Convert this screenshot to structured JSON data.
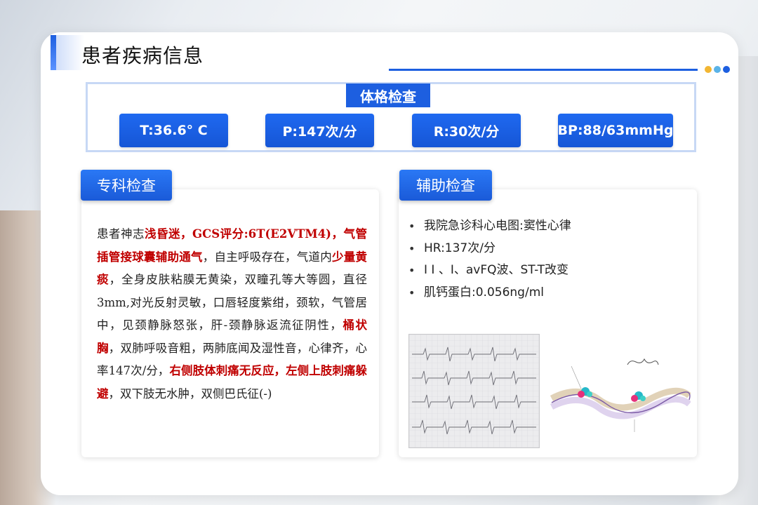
{
  "header": {
    "title": "患者疾病信息"
  },
  "colors": {
    "accent": "#1d5fe0",
    "highlight_red": "#c00000",
    "dots": [
      "#f2b632",
      "#5ab3e8",
      "#1d5fe0"
    ]
  },
  "physical_exam": {
    "title": "体格检查",
    "vitals": [
      {
        "label": "T:36.6° C"
      },
      {
        "label": "P:147次/分"
      },
      {
        "label": "R:30次/分"
      },
      {
        "label": "BP:88/63mmHg"
      }
    ]
  },
  "specialist_exam": {
    "title": "专科检查",
    "segments": [
      {
        "text": "患者神志",
        "red": false
      },
      {
        "text": "浅昏迷，GCS评分:6T(E2VTM4)，气管插管接球囊辅助通气",
        "red": true
      },
      {
        "text": "，自主呼吸存在，气道内",
        "red": false
      },
      {
        "text": "少量黄痰",
        "red": true
      },
      {
        "text": "，全身皮肤粘膜无黄染，双瞳孔等大等圆，直径3mm,对光反射灵敏，口唇轻度紫绀，颈软，气管居中，见颈静脉怒张，肝-颈静脉返流征阴性，",
        "red": false
      },
      {
        "text": "桶状胸",
        "red": true
      },
      {
        "text": "，双肺呼吸音粗，两肺底闻及湿性音，心律齐，心率147次/分，",
        "red": false
      },
      {
        "text": "右侧肢体刺痛无反应，左侧上肢刺痛躲避",
        "red": true
      },
      {
        "text": "，双下肢无水肿，双侧巴氏征(-)",
        "red": false
      }
    ]
  },
  "auxiliary_exam": {
    "title": "辅助检查",
    "items": [
      "我院急诊科心电图:窦性心律",
      "HR:137次/分",
      "I I 、I、avFQ波、ST-T改变",
      "肌钙蛋白:0.056ng/ml"
    ]
  }
}
